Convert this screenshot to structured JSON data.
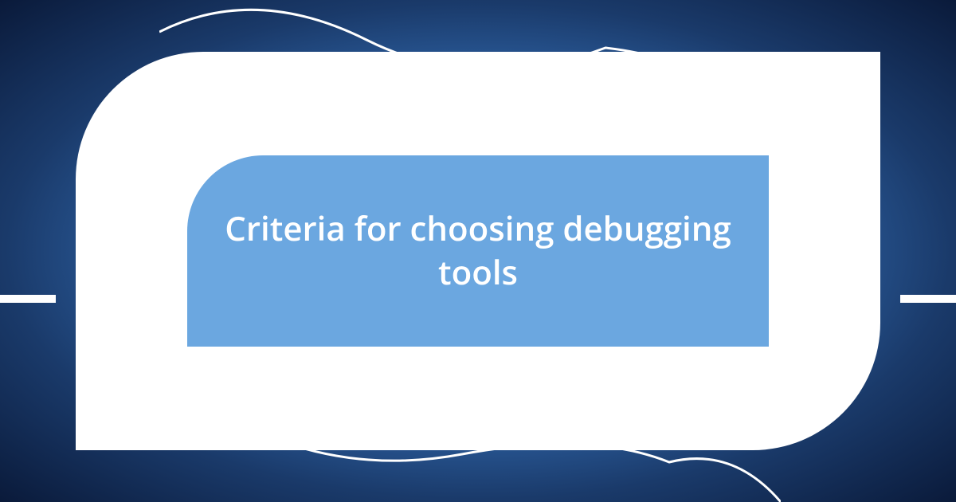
{
  "title": "Criteria for choosing debugging tools",
  "colors": {
    "background_center": "#5a9bd8",
    "background_edge": "#0a1a3a",
    "outer_shape": "#ffffff",
    "inner_shape": "#6ba7e0",
    "text": "#ffffff",
    "curve_stroke": "#ffffff"
  }
}
